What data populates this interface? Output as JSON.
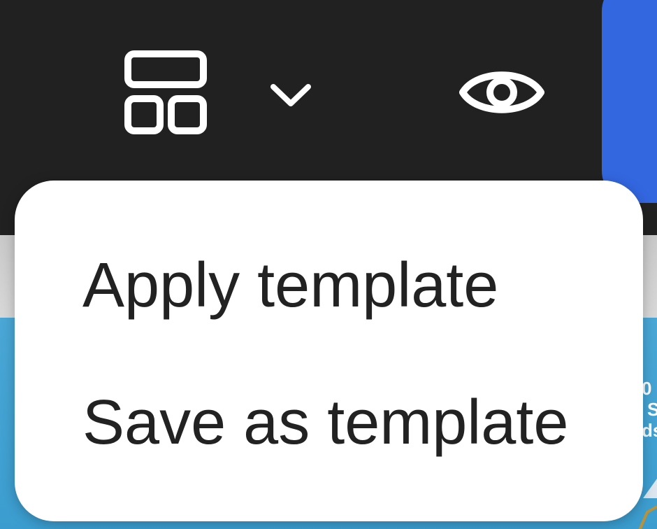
{
  "toolbar": {
    "layout_button_icon": "layout-template-icon",
    "dropdown_icon": "chevron-down-icon",
    "preview_icon": "eye-icon",
    "primary_button_color": "#3367e0",
    "background_color": "#212121"
  },
  "template_menu": {
    "items": [
      {
        "label": "Apply template"
      },
      {
        "label": "Save as template"
      }
    ]
  },
  "canvas": {
    "background_color": "#3b9dcf",
    "partial_text_lines": [
      "0",
      "S",
      "ds"
    ]
  }
}
